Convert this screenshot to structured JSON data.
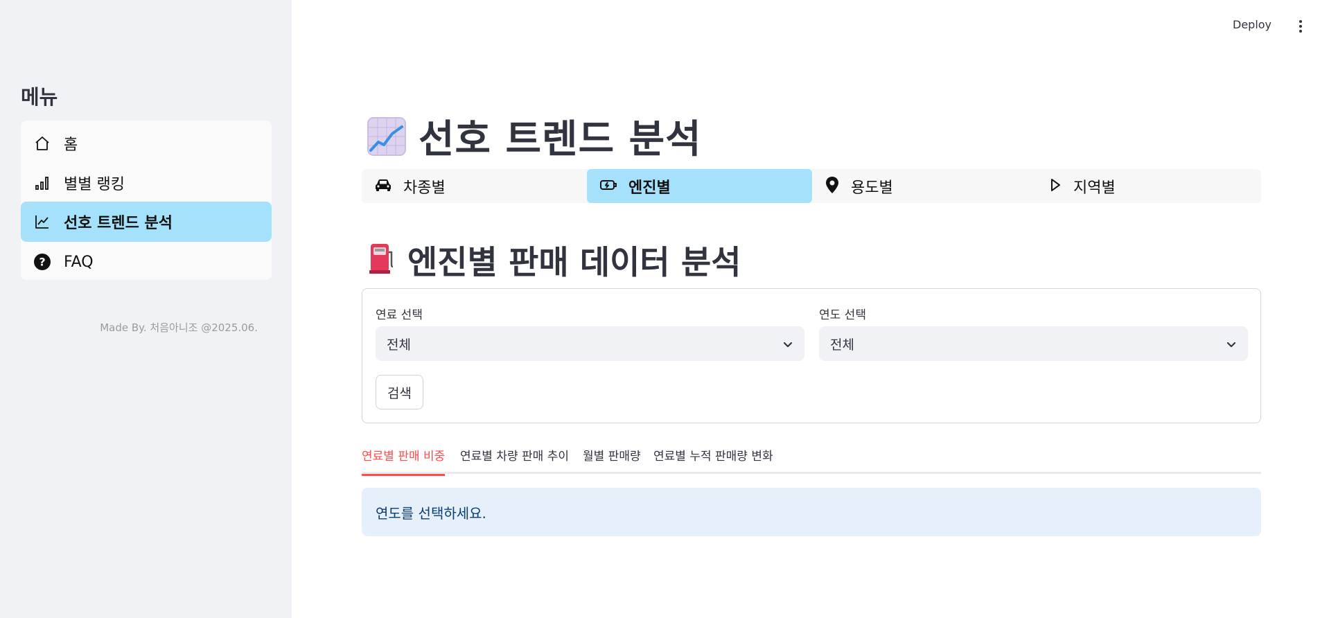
{
  "sidebar": {
    "title": "메뉴",
    "items": [
      {
        "label": "홈",
        "icon": "home-icon",
        "active": false
      },
      {
        "label": "별별 랭킹",
        "icon": "bar-chart-icon",
        "active": false
      },
      {
        "label": "선호 트렌드 분석",
        "icon": "trend-chart-icon",
        "active": true
      },
      {
        "label": "FAQ",
        "icon": "question-circle-icon",
        "active": false
      }
    ],
    "footer": "Made By. 처음아니조 @2025.06."
  },
  "header": {
    "deploy_label": "Deploy",
    "menu_icon": "kebab-menu-icon"
  },
  "main": {
    "title": "선호 트렌드 분석",
    "title_icon": "chart-increasing-emoji",
    "top_tabs": [
      {
        "label": "차종별",
        "icon": "car-icon",
        "active": false
      },
      {
        "label": "엔진별",
        "icon": "ev-charge-icon",
        "active": true
      },
      {
        "label": "용도별",
        "icon": "map-pin-icon",
        "active": false
      },
      {
        "label": "지역별",
        "icon": "play-icon",
        "active": false
      }
    ],
    "section_title": "엔진별 판매 데이터 분석",
    "section_icon": "fuel-pump-emoji",
    "filters": {
      "fuel_label": "연료 선택",
      "fuel_value": "전체",
      "year_label": "연도 선택",
      "year_value": "전체",
      "search_label": "검색"
    },
    "sub_tabs": [
      {
        "label": "연료별 판매 비중",
        "active": true
      },
      {
        "label": "연료별 차량 판매 추이",
        "active": false
      },
      {
        "label": "월별 판매량",
        "active": false
      },
      {
        "label": "연료별 누적 판매량 변화",
        "active": false
      }
    ],
    "info_message": "연도를 선택하세요."
  },
  "colors": {
    "sidebar_bg": "#f0f2f6",
    "active_highlight": "#a6e1fb",
    "accent_red": "#ff4b4b",
    "info_bg": "#e6f0fb",
    "info_text": "#0a3d73"
  }
}
